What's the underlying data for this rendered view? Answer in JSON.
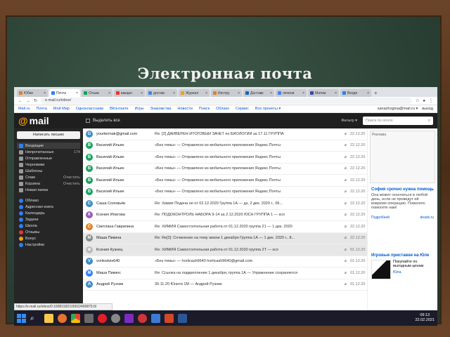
{
  "slide": {
    "title": "Электронная почта"
  },
  "browser": {
    "tabs": [
      {
        "label": "Юбки",
        "color": "#e67e22"
      },
      {
        "label": "Почта",
        "color": "#2d7ff9",
        "active": true
      },
      {
        "label": "Отзыв",
        "color": "#0a5"
      },
      {
        "label": "вакцин",
        "color": "#e33"
      },
      {
        "label": "достав",
        "color": "#4285f4"
      },
      {
        "label": "Журнал",
        "color": "#f0a30a"
      },
      {
        "label": "Инстру",
        "color": "#e67e22"
      },
      {
        "label": "Доставк",
        "color": "#1565c0"
      },
      {
        "label": "лечени",
        "color": "#4285f4"
      },
      {
        "label": "Матем",
        "color": "#3949ab"
      },
      {
        "label": "Входя",
        "color": "#2d7ff9"
      }
    ],
    "url": "e.mail.ru/inbox/",
    "new_tab": "+"
  },
  "portal": {
    "links": [
      "Mail.ru",
      "Почта",
      "Мой Мир",
      "Одноклассники",
      "ВКонтакте",
      "Игры",
      "Знакомства",
      "Новости",
      "Поиск",
      "Облако",
      "Сервис",
      "Все проекты ▾"
    ],
    "user": "sanazhogina@mail.ru ▾",
    "logout": "выход"
  },
  "mail": {
    "logo_at": "@",
    "logo_text": "mail",
    "select_all": "Выделить все",
    "filter": "Фильтр ▾",
    "search_placeholder": "Поиск по почте",
    "compose": "Написать письмо",
    "folders": [
      {
        "label": "Входящие",
        "count": "",
        "color": "#2d7ff9",
        "selected": true
      },
      {
        "label": "Непрочитанные",
        "count": "174",
        "color": "#999"
      },
      {
        "label": "Отправленные",
        "count": "",
        "color": "#999"
      },
      {
        "label": "Черновики",
        "count": "",
        "color": "#999"
      },
      {
        "label": "Шаблоны",
        "count": "",
        "color": "#999"
      },
      {
        "label": "Спам",
        "count": "Очистить",
        "color": "#999"
      },
      {
        "label": "Корзина",
        "count": "Очистить",
        "color": "#999"
      },
      {
        "label": "Новая папка",
        "count": "",
        "color": "#999"
      }
    ],
    "apps": [
      {
        "label": "Облако",
        "color": "#2d7ff9"
      },
      {
        "label": "Адресная книга",
        "color": "#2d7ff9"
      },
      {
        "label": "Календарь",
        "color": "#2d7ff9"
      },
      {
        "label": "Задачи",
        "color": "#2d7ff9"
      },
      {
        "label": "Школа",
        "color": "#2d7ff9"
      },
      {
        "label": "Отзывы",
        "color": "#e33"
      },
      {
        "label": "Бонус",
        "color": "#f0a30a"
      },
      {
        "label": "Настройки",
        "color": "#2d7ff9"
      }
    ],
    "messages": [
      {
        "avatar": "G",
        "color": "#3f8cc7",
        "from": "yourtermak@gmail.com",
        "subject": "Re: [2] ДАЙВЁРЕН ИТОГОВЫЙ ЗАЧЁТ по БИОЛОГИИ за 17.11 ГРУППА",
        "date": "22.12.20"
      },
      {
        "avatar": "В",
        "color": "#1aa360",
        "from": "Василий Ильин",
        "subject": "«Без темы» — Отправлено из мобильного приложения Яндекс.Почты",
        "date": "22.12.20"
      },
      {
        "avatar": "В",
        "color": "#1aa360",
        "from": "Василий Ильин",
        "subject": "«Без темы» — Отправлено из мобильного приложения Яндекс.Почты",
        "date": "22.12.20"
      },
      {
        "avatar": "В",
        "color": "#1aa360",
        "from": "Василий Ильин",
        "subject": "«Без темы» — Отправлено из мобильного приложения Яндекс.Почты",
        "date": "22.12.20"
      },
      {
        "avatar": "В",
        "color": "#1aa360",
        "from": "Василий Ильин",
        "subject": "«Без темы» — Отправлено из мобильного приложения Яндекс.Почты",
        "date": "22.12.20"
      },
      {
        "avatar": "В",
        "color": "#1aa360",
        "from": "Василий Ильин",
        "subject": "«Без темы» — Отправлено из мобильного приложения Яндекс.Почты",
        "date": "22.12.20"
      },
      {
        "avatar": "С",
        "color": "#3f8cc7",
        "from": "Саша Соловьёв",
        "subject": "Re: Химия Подача не от 02.12.2020 Группа 1А — дз, 2 дек. 2020 г., 06...",
        "date": "22.12.20"
      },
      {
        "avatar": "К",
        "color": "#9b59b6",
        "from": "Ксения Ипатова",
        "subject": "Re: ПОДОКОНТРОЛЬ НАБОРА 9-14 за 2.12.2020 ЮСН ГРУППА 1 — ксо",
        "date": "22.12.20"
      },
      {
        "avatar": "С",
        "color": "#e67e22",
        "from": "Светлана Гаврилина",
        "subject": "Re: ХИМИЯ Самостоятельная работа от 01.12.2020 группа 21 — 1 дек. 2020",
        "date": "22.12.20"
      },
      {
        "avatar": "М",
        "color": "#7f8c8d",
        "from": "Маша Пикина",
        "subject": "Re: Re[2]: Сочинение на тему жизни 1 декабря Группа 1А — 1 дек. 2020 г., 8...",
        "date": "22.12.20",
        "highlight": true
      },
      {
        "avatar": "★",
        "color": "#bbb",
        "from": "Ксения Кузнец",
        "subject": "Re: ХИМИЯ Самостоятельная работа от 01.12.2020 группа 2Т — ксо",
        "date": "01.12.20",
        "highlight": true
      },
      {
        "avatar": "V",
        "color": "#3f8cc7",
        "from": "vorliostvis640",
        "subject": "«Без темы» — horlicash9640 horlicash9640@gmail.com",
        "date": "01.12.20"
      },
      {
        "avatar": "М",
        "color": "#2d7ff9",
        "from": "Миша Пикинс",
        "subject": "Re: Ссылка на подкрепление 1 декабря, группа 1А — Упражнение сохраняется",
        "date": "01.12.20"
      },
      {
        "avatar": "А",
        "color": "#3f8cc7",
        "from": "Андрей Рузник",
        "subject": "30.11.20 Юнити 1М — Андрей Рузник",
        "date": "01.12.20"
      }
    ]
  },
  "ads": {
    "ad1_label": "Реклама",
    "ad2_title": "София срочно нужна помощь",
    "ad2_text": "Она может скончаться в любой день, если не проведут ей вовремя операцию. Помогите, помогите нам!",
    "ad2_more": "Подробней",
    "ad2_source": "deads.ru",
    "ad3_title": "Игровые приставки на Юле",
    "ad3_text": "Покупайте по выгодным ценам",
    "ad3_source": "Юла"
  },
  "status_bar": "https://e.mail.ru/inbox/0:16083182100022400875:0/",
  "taskbar": {
    "time": "09:13",
    "date": "22.02.2021"
  }
}
